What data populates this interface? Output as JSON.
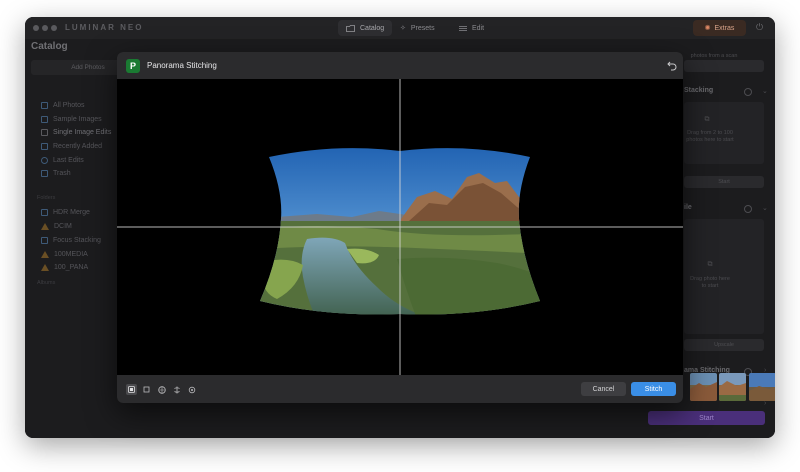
{
  "app": {
    "brand": "LUMINAR NEO",
    "nav": [
      {
        "label": "Catalog",
        "icon": "folder-icon",
        "active": true
      },
      {
        "label": "Presets",
        "icon": "sparkle-icon",
        "active": false
      },
      {
        "label": "Edit",
        "icon": "sliders-icon",
        "active": false
      }
    ],
    "extras_label": "Extras"
  },
  "sidebar": {
    "title": "Catalog",
    "add_photos": "Add Photos",
    "items": [
      {
        "label": "All Photos",
        "icon": "photos-icon"
      },
      {
        "label": "Sample Images",
        "icon": "sample-icon"
      },
      {
        "label": "Single Image Edits",
        "icon": "grid-icon",
        "active": true
      },
      {
        "label": "Recently Added",
        "icon": "calendar-icon"
      },
      {
        "label": "Last Edits",
        "icon": "clock-icon"
      },
      {
        "label": "Trash",
        "icon": "trash-icon"
      }
    ],
    "folders_header": "Folders",
    "folders": [
      {
        "label": "HDR Merge",
        "icon": "folder-icon"
      },
      {
        "label": "DCIM",
        "icon": "warning-icon"
      },
      {
        "label": "Focus Stacking",
        "icon": "folder-icon"
      },
      {
        "label": "100MEDIA",
        "icon": "warning-icon"
      },
      {
        "label": "100_PANA",
        "icon": "warning-icon"
      }
    ],
    "albums_header": "Albums"
  },
  "right_panel": {
    "top_note": "photos from a scan",
    "stacking_title": "Stacking",
    "stacking_drop_line1": "Drag from 2 to 100",
    "stacking_drop_line2": "photos here to start",
    "stacking_button": "Start",
    "single_title": "ile",
    "single_drop_line1": "Drag photo here",
    "single_drop_line2": "to start",
    "single_button": "Upscale",
    "panorama_title": "ama Stitching",
    "start_button": "Start"
  },
  "dialog": {
    "title": "Panorama Stitching",
    "logo_letter": "P",
    "tools": [
      "fit-icon",
      "crop-icon",
      "globe-icon",
      "projection-icon",
      "settings-icon"
    ],
    "cancel_label": "Cancel",
    "stitch_label": "Stitch"
  },
  "colors": {
    "accent_blue": "#3a8ee6",
    "start_purple": "#4a2f7a",
    "logo_green": "#1a7a32"
  }
}
